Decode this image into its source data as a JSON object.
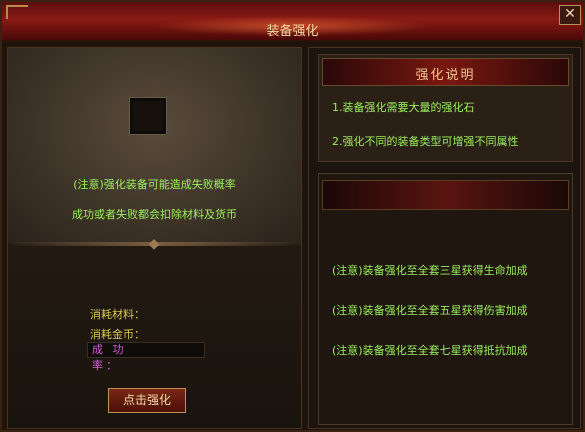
{
  "window": {
    "title": "装备强化",
    "close_label": "✕"
  },
  "left": {
    "notes": [
      "(注意)强化装备可能造成失败概率",
      "成功或者失败都会扣除材料及货币"
    ],
    "cost_material_label": "消耗材料：",
    "cost_gold_label": "消耗金币：",
    "success_rate_label": "成 功 率：",
    "enhance_button": "点击强化"
  },
  "right": {
    "header": "强化说明",
    "info": [
      "1.装备强化需要大量的强化石",
      "2.强化不同的装备类型可增强不同属性"
    ],
    "tips": [
      "(注意)装备强化至全套三星获得生命加成",
      "(注意)装备强化至全套五星获得伤害加成",
      "(注意)装备强化至全套七星获得抵抗加成"
    ]
  },
  "colors": {
    "accent_text": "#9cf05c",
    "label_yellow": "#d8c84a",
    "label_purple": "#d060d8",
    "title_red": "#8a1a14"
  }
}
